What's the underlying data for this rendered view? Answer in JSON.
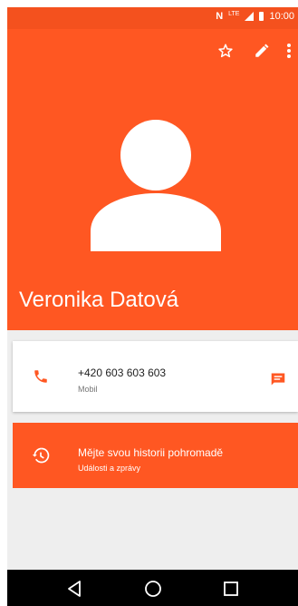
{
  "status_bar": {
    "nfc": "N",
    "network": "LTE",
    "time": "10:00"
  },
  "toolbar": {
    "star_icon": "star-icon",
    "edit_icon": "pencil-icon",
    "more_icon": "more-vert-icon"
  },
  "contact": {
    "name": "Veronika Datová",
    "avatar": "person-avatar-icon"
  },
  "phone_card": {
    "number": "+420 603 603 603",
    "type": "Mobil",
    "phone_icon": "phone-icon",
    "message_icon": "message-icon"
  },
  "history_card": {
    "title": "Mějte svou historii pohromadě",
    "subtitle": "Události a zprávy",
    "icon": "history-icon"
  },
  "nav_bar": {
    "back_icon": "back-triangle-icon",
    "home_icon": "home-circle-icon",
    "recents_icon": "recents-square-icon"
  },
  "colors": {
    "header": "#ff5722",
    "status_bar": "#f4511e",
    "accent": "#ff5722"
  }
}
